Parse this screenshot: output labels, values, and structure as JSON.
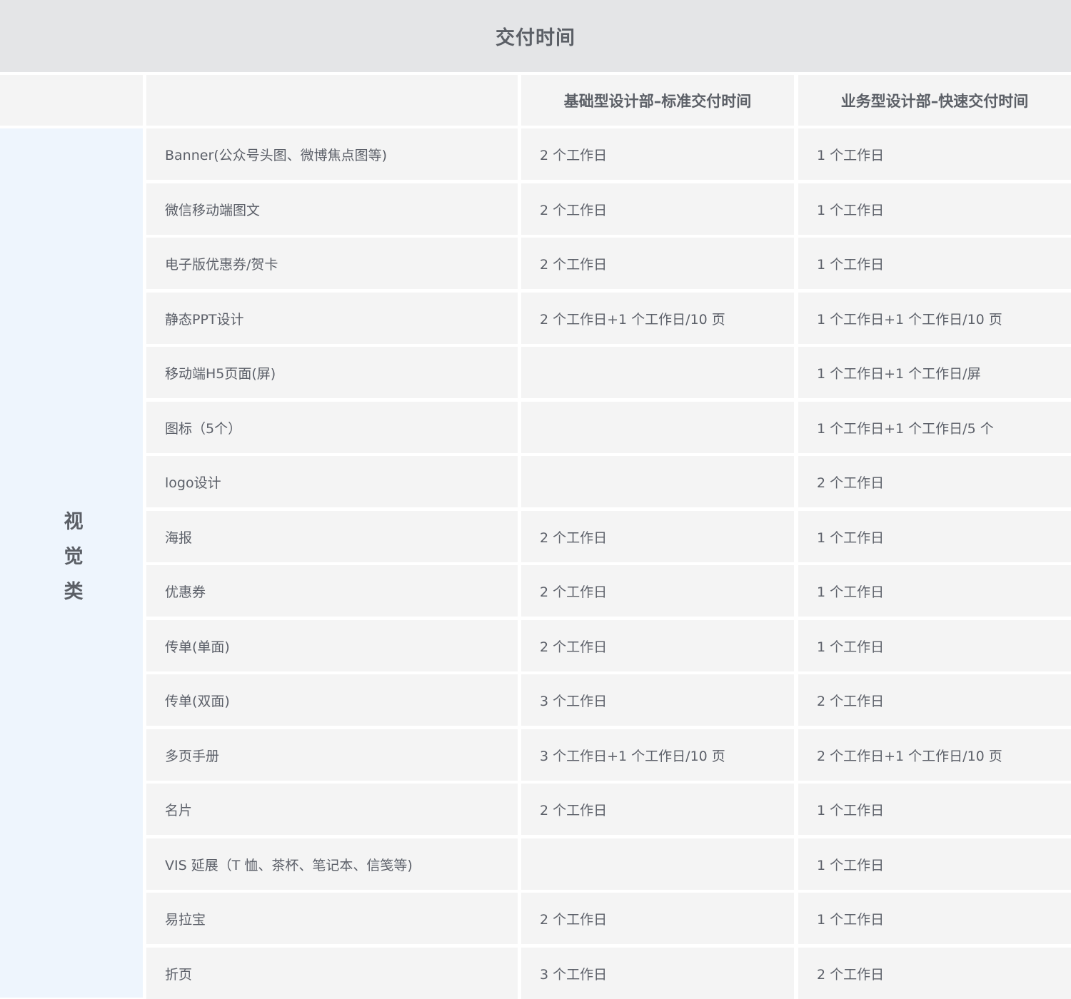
{
  "title": "交付时间",
  "header": {
    "corner": "",
    "item": "",
    "standard": "基础型设计部–标准交付时间",
    "fast": "业务型设计部–快速交付时间"
  },
  "category": "视觉类",
  "rows": [
    {
      "item": "Banner(公众号头图、微博焦点图等)",
      "standard": "2 个工作日",
      "fast": "1 个工作日"
    },
    {
      "item": "微信移动端图文",
      "standard": "2 个工作日",
      "fast": "1 个工作日"
    },
    {
      "item": "电子版优惠券/贺卡",
      "standard": "2 个工作日",
      "fast": "1 个工作日"
    },
    {
      "item": "静态PPT设计",
      "standard": "2 个工作日+1 个工作日/10 页",
      "fast": "1 个工作日+1 个工作日/10 页"
    },
    {
      "item": "移动端H5页面(屏)",
      "standard": "",
      "fast": "1 个工作日+1 个工作日/屏"
    },
    {
      "item": "图标（5个）",
      "standard": "",
      "fast": "1 个工作日+1 个工作日/5 个"
    },
    {
      "item": "logo设计",
      "standard": "",
      "fast": "2 个工作日"
    },
    {
      "item": "海报",
      "standard": "2 个工作日",
      "fast": "1 个工作日"
    },
    {
      "item": "优惠券",
      "standard": "2 个工作日",
      "fast": "1 个工作日"
    },
    {
      "item": "传单(单面)",
      "standard": "2 个工作日",
      "fast": "1 个工作日"
    },
    {
      "item": "传单(双面)",
      "standard": "3 个工作日",
      "fast": "2 个工作日"
    },
    {
      "item": "多页手册",
      "standard": "3 个工作日+1 个工作日/10 页",
      "fast": "2 个工作日+1 个工作日/10 页"
    },
    {
      "item": "名片",
      "standard": "2 个工作日",
      "fast": "1 个工作日"
    },
    {
      "item": "VIS 延展（T 恤、茶杯、笔记本、信笺等)",
      "standard": "",
      "fast": "1 个工作日"
    },
    {
      "item": "易拉宝",
      "standard": "2 个工作日",
      "fast": "1 个工作日"
    },
    {
      "item": "折页",
      "standard": "3 个工作日",
      "fast": "2 个工作日"
    }
  ]
}
